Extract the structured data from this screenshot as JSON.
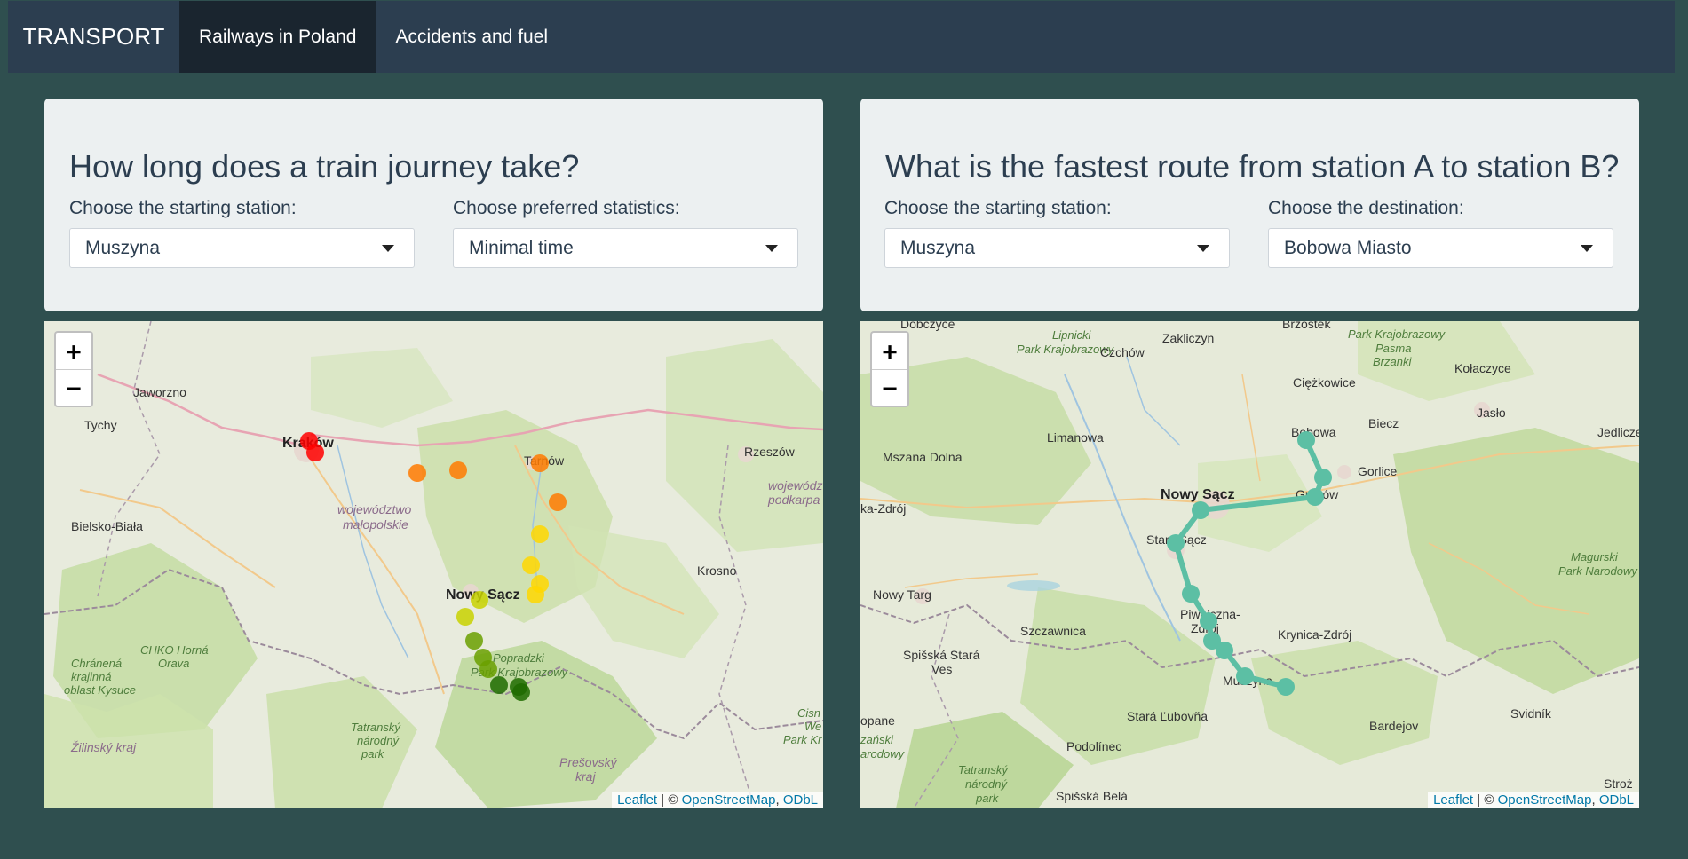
{
  "navbar": {
    "brand": "TRANSPORT",
    "tabs": [
      {
        "label": "Railways in Poland",
        "active": true
      },
      {
        "label": "Accidents and fuel",
        "active": false
      }
    ]
  },
  "left_panel": {
    "title": "How long does a train journey take?",
    "start_label": "Choose the starting station:",
    "start_value": "Muszyna",
    "stat_label": "Choose preferred statistics:",
    "stat_value": "Minimal time"
  },
  "right_panel": {
    "title": "What is the fastest route from station A to station B?",
    "start_label": "Choose the starting station:",
    "start_value": "Muszyna",
    "dest_label": "Choose the destination:",
    "dest_value": "Bobowa Miasto"
  },
  "map_common": {
    "zoom_in": "+",
    "zoom_out": "−",
    "attribution_leaflet": "Leaflet",
    "attribution_sep": " | © ",
    "attribution_osm": "OpenStreetMap",
    "attribution_comma": ", ",
    "attribution_odbl": "ODbL"
  },
  "left_map": {
    "places": {
      "jaworzno": "Jaworzno",
      "tychy": "Tychy",
      "krakow": "Kraków",
      "tarnow": "Tarnów",
      "rzeszow": "Rzeszów",
      "malopolskie1": "województwo",
      "malopolskie2": "małopolskie",
      "bielsko": "Bielsko-Biała",
      "krosno": "Krosno",
      "nowy_sacz": "Nowy Sącz",
      "podkarpackie1": "wojewódz",
      "podkarpackie2": "podkarpa",
      "chko1": "CHKO Horná",
      "chko2": "Orava",
      "chranena1": "Chránená",
      "chranena2": "krajinná",
      "chranena3": "oblast Kysuce",
      "tatransky1": "Tatranský",
      "tatransky2": "národný",
      "tatransky3": "park",
      "zilinsky": "Žilinský kraj",
      "presovsky1": "Prešovský",
      "presovsky2": "kraj",
      "poprad1": "Popradzki",
      "poprad2": "Park Krajobrazowy",
      "cisne1": "Cisn",
      "cisne2": "We",
      "cisne3": "Park Kr"
    },
    "color_scale": [
      "#ff0000",
      "#ff7a00",
      "#ffd700",
      "#c8d200",
      "#6aa000",
      "#1f6b00"
    ]
  },
  "right_map": {
    "places": {
      "dobczyce": "Dobczyce",
      "lipnicki1": "Lipnicki",
      "lipnicki2": "Park Krajobrazowy",
      "zakliczyn": "Zakliczyn",
      "brzostek": "Brzostek",
      "pasmo1": "Park Krajobrazowy",
      "pasmo2": "Pasma",
      "pasmo3": "Brzanki",
      "czchow": "Czchów",
      "ciezkowice": "Ciężkowice",
      "kolaczyce": "Kołaczyce",
      "jaslo": "Jasło",
      "biecz": "Biecz",
      "bobowa": "Bobowa",
      "jedlicze": "Jedlicze",
      "limanowa": "Limanowa",
      "mszana": "Mszana Dolna",
      "gorlice": "Gorlice",
      "grybow": "Grybów",
      "nowy_sacz": "Nowy Sącz",
      "zdroj": "ka-Zdrój",
      "stary_sacz": "Stary Sącz",
      "magurski1": "Magurski",
      "magurski2": "Park Narodowy",
      "nowy_targ": "Nowy Targ",
      "piwniczna1": "Piwniczna-",
      "piwniczna2": "Zdrój",
      "szczawnica": "Szczawnica",
      "krynica": "Krynica-Zdrój",
      "spisska1": "Spišská Stará",
      "spisska2": "Ves",
      "muszyna": "Muszyna",
      "svidnik": "Svidník",
      "stara_lubovna": "Stará Ľubovňa",
      "bardejov": "Bardejov",
      "opane": "opane",
      "zanski": "zański",
      "arodowy": "arodowy",
      "podolinec": "Podolínec",
      "tatransky1": "Tatranský",
      "tatransky2": "národný",
      "tatransky3": "park",
      "spisska_bela": "Spišská Belá",
      "strozk": "Stroż"
    },
    "route_color": "#5cbfa4"
  }
}
